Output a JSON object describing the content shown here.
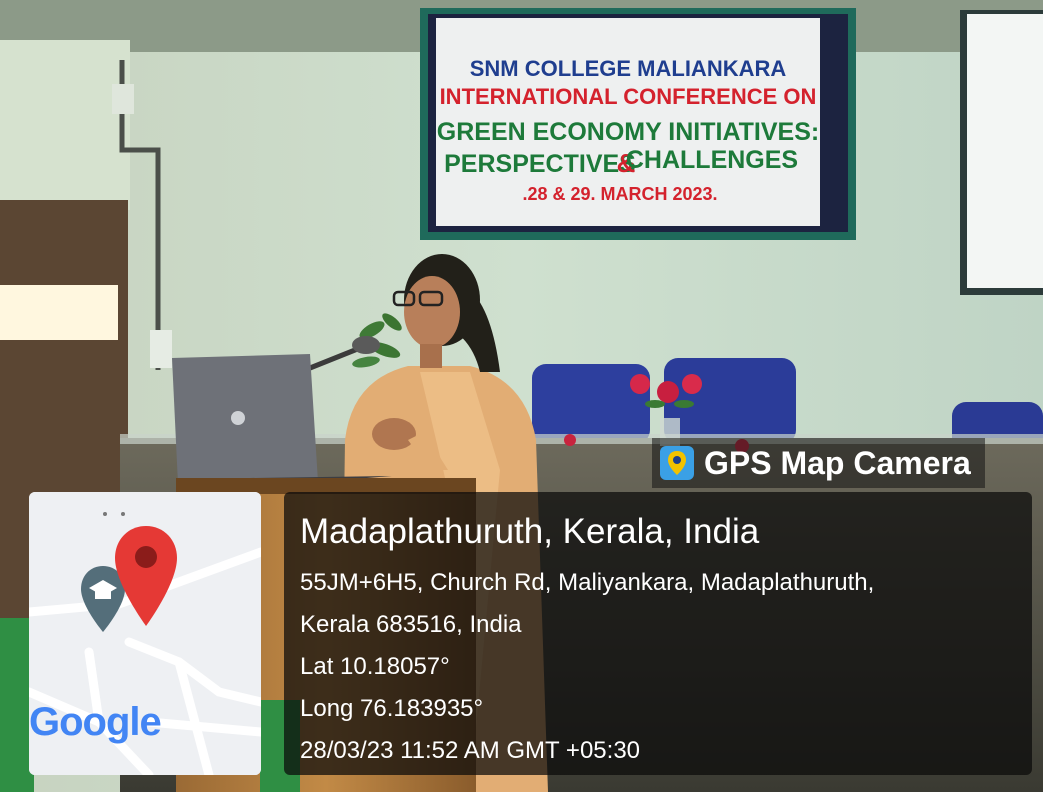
{
  "banner": {
    "line1": "SNM COLLEGE MALIANKARA",
    "line2": "INTERNATIONAL CONFERENCE ON",
    "line3": "GREEN ECONOMY INITIATIVES:",
    "line4a": "PERSPECTIVES",
    "line4amp": "&",
    "line4b": "CHALLENGES",
    "line5": ".28 & 29. MARCH 2023."
  },
  "overlay": {
    "app_name": "GPS Map Camera",
    "app_icon": "map-pin-icon",
    "map_logo": "Google",
    "map_icons": [
      "location-pin-icon",
      "graduation-cap-icon"
    ],
    "place": "Madaplathuruth, Kerala, India",
    "address_line1": "55JM+6H5, Church Rd, Maliyankara, Madaplathuruth,",
    "address_line2": "Kerala 683516, India",
    "lat": "Lat 10.18057°",
    "long": "Long 76.183935°",
    "timestamp": "28/03/23 11:52 AM GMT +05:30"
  },
  "colors": {
    "wall": "#c8d8c6",
    "banner_border": "#1e6b5c",
    "saree": "#e2ad74",
    "chair": "#2d3f9e",
    "pin_red": "#e53935",
    "overlay_bg": "#1a1a1a"
  }
}
